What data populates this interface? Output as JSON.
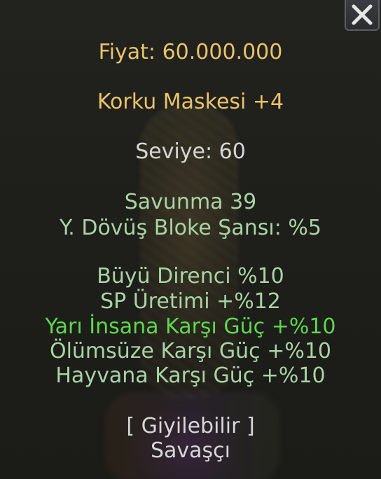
{
  "tooltip": {
    "close_icon": "close-icon",
    "price": "Fiyat: 60.000.000",
    "item_name": "Korku Maskesi +4",
    "level": "Seviye: 60",
    "defense": "Savunma 39",
    "block_chance": "Y. Dövüş Bloke Şansı: %5",
    "attributes": [
      "Büyü Direnci %10",
      "SP Üretimi +%12",
      "Yarı İnsana Karşı Güç +%10",
      "Ölümsüze Karşı Güç +%10",
      "Hayvana Karşı Güç +%10"
    ],
    "wearable": "[ Giyilebilir ]",
    "class": "Savaşçı"
  },
  "colors": {
    "price": "#e8c36b",
    "item_name": "#e8c36b",
    "level": "#d6d6d6",
    "stats": "#a9d3a6",
    "highlight_bonus": "#5fd651",
    "wearable": "#d6d6d6"
  }
}
